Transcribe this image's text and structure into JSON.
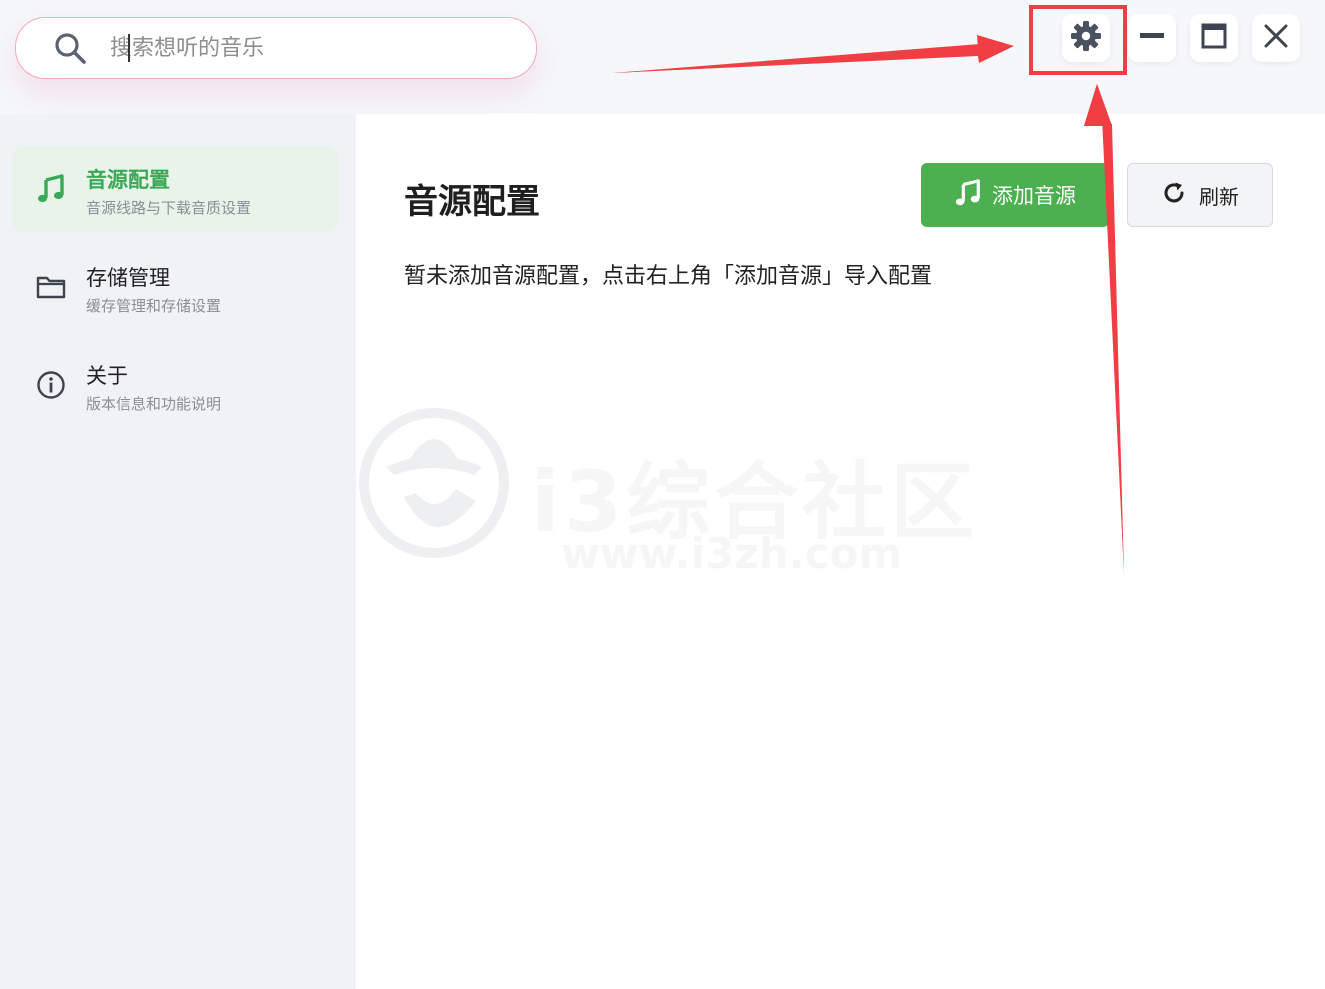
{
  "search": {
    "placeholder": "搜索想听的音乐",
    "value": ""
  },
  "window_controls": {
    "settings_icon": "gear-icon",
    "minimize_icon": "minimize-icon",
    "maximize_icon": "maximize-icon",
    "close_icon": "close-icon"
  },
  "sidebar": {
    "items": [
      {
        "title": "音源配置",
        "subtitle": "音源线路与下载音质设置",
        "icon": "music-note-icon",
        "active": true
      },
      {
        "title": "存储管理",
        "subtitle": "缓存管理和存储设置",
        "icon": "folder-icon",
        "active": false
      },
      {
        "title": "关于",
        "subtitle": "版本信息和功能说明",
        "icon": "info-icon",
        "active": false
      }
    ]
  },
  "main": {
    "title": "音源配置",
    "add_button_label": "添加音源",
    "refresh_button_label": "刷新",
    "empty_hint": "暂未添加音源配置，点击右上角「添加音源」导入配置"
  },
  "watermark": {
    "title": "i3综合社区",
    "url": "www.i3zh.com"
  },
  "colors": {
    "accent_green": "#4caf50",
    "active_text_green": "#3aa856",
    "annotation_red": "#ef3f44",
    "search_border_pink": "#f0a8c2"
  }
}
